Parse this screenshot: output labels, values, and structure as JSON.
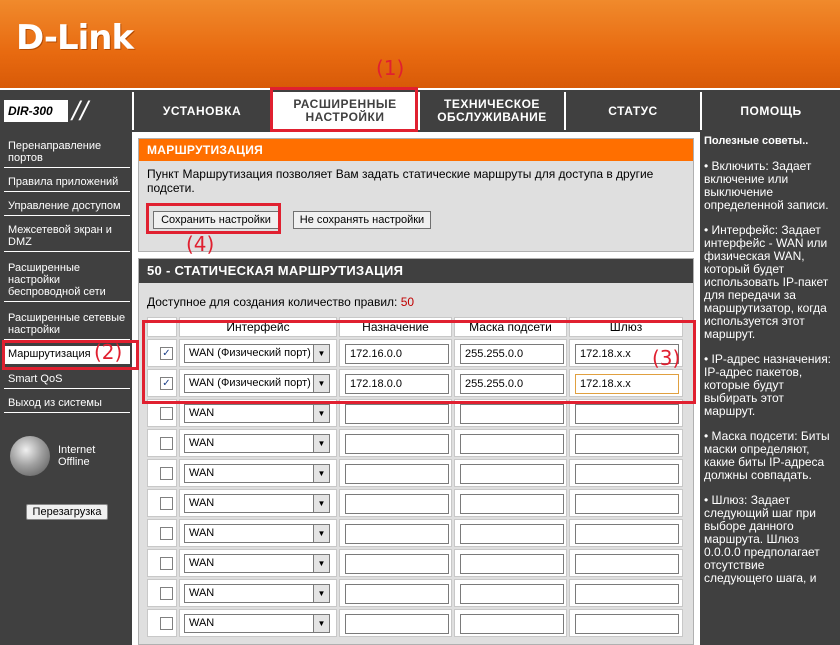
{
  "header": {
    "logo": "D-Link"
  },
  "model": {
    "name": "DIR-300"
  },
  "tabs": [
    {
      "label_line1": "УСТАНОВКА",
      "label_line2": ""
    },
    {
      "label_line1": "РАСШИРЕННЫЕ",
      "label_line2": "НАСТРОЙКИ"
    },
    {
      "label_line1": "ТЕХНИЧЕСКОЕ",
      "label_line2": "ОБСЛУЖИВАНИЕ"
    },
    {
      "label_line1": "СТАТУС",
      "label_line2": ""
    },
    {
      "label_line1": "ПОМОЩЬ",
      "label_line2": ""
    }
  ],
  "sidebar": {
    "items": [
      {
        "label": "Перенаправление портов"
      },
      {
        "label": "Правила приложений"
      },
      {
        "label": "Управление доступом"
      },
      {
        "label": "Межсетевой экран и DMZ"
      },
      {
        "label": "Расширенные настройки беспроводной сети"
      },
      {
        "label": "Расширенные сетевые настройки"
      },
      {
        "label": "Маршрутизация"
      },
      {
        "label": "Smart QoS"
      },
      {
        "label": "Выход из системы"
      }
    ],
    "internet_line1": "Internet",
    "internet_line2": "Offline",
    "reboot_label": "Перезагрузка"
  },
  "routing": {
    "title": "МАРШРУТИЗАЦИЯ",
    "description": "Пункт Маршрутизация позволяет Вам задать статические маршруты для доступа в другие подсети.",
    "save_label": "Сохранить настройки",
    "nosave_label": "Не сохранять настройки"
  },
  "static_routing": {
    "title": "50 - СТАТИЧЕСКАЯ МАРШРУТИЗАЦИЯ",
    "rules_text": "Доступное для создания количество правил: ",
    "rules_count": "50",
    "columns": [
      "Интерфейс",
      "Назначение",
      "Маска подсети",
      "Шлюз"
    ],
    "rows": [
      {
        "checked": true,
        "interface": "WAN (Физический порт)",
        "destination": "172.16.0.0",
        "mask": "255.255.0.0",
        "gateway": "172.18.x.x"
      },
      {
        "checked": true,
        "interface": "WAN (Физический порт)",
        "destination": "172.18.0.0",
        "mask": "255.255.0.0",
        "gateway": "172.18.x.x"
      },
      {
        "checked": false,
        "interface": "WAN",
        "destination": "",
        "mask": "",
        "gateway": ""
      },
      {
        "checked": false,
        "interface": "WAN",
        "destination": "",
        "mask": "",
        "gateway": ""
      },
      {
        "checked": false,
        "interface": "WAN",
        "destination": "",
        "mask": "",
        "gateway": ""
      },
      {
        "checked": false,
        "interface": "WAN",
        "destination": "",
        "mask": "",
        "gateway": ""
      },
      {
        "checked": false,
        "interface": "WAN",
        "destination": "",
        "mask": "",
        "gateway": ""
      },
      {
        "checked": false,
        "interface": "WAN",
        "destination": "",
        "mask": "",
        "gateway": ""
      },
      {
        "checked": false,
        "interface": "WAN",
        "destination": "",
        "mask": "",
        "gateway": ""
      },
      {
        "checked": false,
        "interface": "WAN",
        "destination": "",
        "mask": "",
        "gateway": ""
      }
    ]
  },
  "help": {
    "title": "Полезные советы..",
    "items": [
      "• Включить: Задает включение или выключение определенной записи.",
      "• Интерфейс: Задает интерфейс - WAN или физическая WAN, который будет использовать IP-пакет для передачи за маршрутизатор, когда используется этот маршрут.",
      "• IP-адрес назначения: IP-адрес пакетов, которые будут выбирать этот маршрут.",
      "• Маска подсети: Биты маски определяют, какие биты IP-адреса должны совпадать.",
      "• Шлюз: Задает следующий шаг при выборе данного маршрута. Шлюз 0.0.0.0 предполагает отсутствие следующего шага, и"
    ]
  },
  "annotations": [
    "(1)",
    "(2)",
    "(3)",
    "(4)"
  ],
  "colors": {
    "accent": "#ff6f00",
    "dark": "#404040",
    "annotation": "#e02030"
  }
}
